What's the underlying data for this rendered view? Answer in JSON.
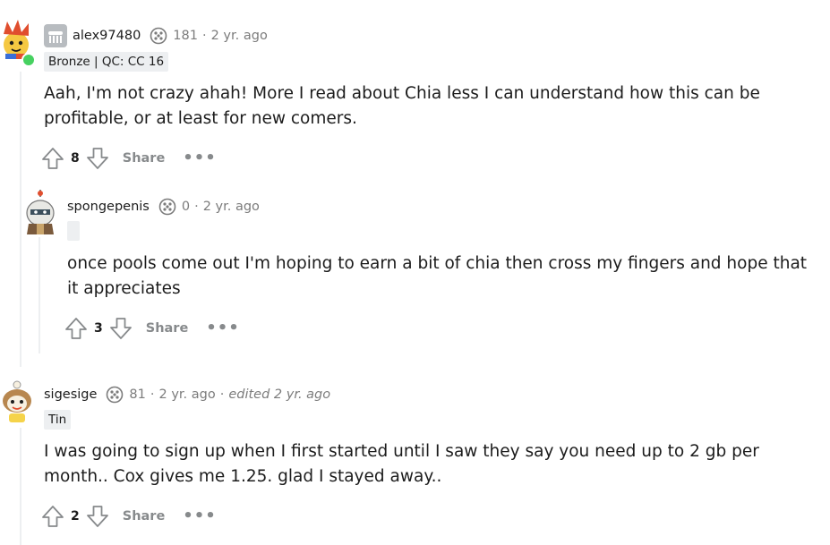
{
  "comments": [
    {
      "username": "alex97480",
      "karma": "181",
      "time": "2 yr. ago",
      "edited": "",
      "flair": "Bronze | QC: CC 16",
      "body": "Aah, I'm not crazy ahah! More I read about Chia less I can understand how this can be profitable, or at least for new comers.",
      "score": "8",
      "share_label": "Share",
      "more_label": "•••"
    },
    {
      "username": "spongepenis",
      "karma": "0",
      "time": "2 yr. ago",
      "edited": "",
      "flair": "",
      "body": "once pools come out I'm hoping to earn a bit of chia then cross my fingers and hope that it appreciates",
      "score": "3",
      "share_label": "Share",
      "more_label": "•••"
    },
    {
      "username": "sigesige",
      "karma": "81",
      "time": "2 yr. ago",
      "edited": "edited 2 yr. ago",
      "flair": "Tin",
      "body": "I was going to sign up when I first started until I saw they say you need up to 2 gb per month.. Cox gives me 1.25. glad I stayed away..",
      "score": "2",
      "share_label": "Share",
      "more_label": "•••"
    }
  ],
  "separator": "·",
  "colors": {
    "online": "#46d160",
    "meta_gray": "#7c7c7c",
    "flair_bg": "#edeff1",
    "thread_line": "#edeff1"
  }
}
